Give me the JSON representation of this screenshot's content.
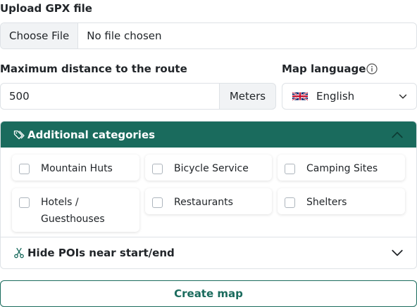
{
  "upload": {
    "label": "Upload GPX file",
    "button": "Choose File",
    "status": "No file chosen"
  },
  "distance": {
    "label": "Maximum distance to the route",
    "value": "500",
    "unit": "Meters"
  },
  "language": {
    "label": "Map language",
    "selected": "English",
    "info_icon": "info-circle-icon"
  },
  "categories": {
    "title": "Additional categories",
    "header_color": "#1a6b5d",
    "items": [
      {
        "label": "Mountain Huts",
        "checked": false
      },
      {
        "label": "Bicycle Service",
        "checked": false
      },
      {
        "label": "Camping Sites",
        "checked": false
      },
      {
        "label": "Hotels / Guesthouses",
        "checked": false
      },
      {
        "label": "Restaurants",
        "checked": false
      },
      {
        "label": "Shelters",
        "checked": false
      }
    ]
  },
  "hide_pois": {
    "title": "Hide POIs near start/end"
  },
  "create_button": "Create map"
}
